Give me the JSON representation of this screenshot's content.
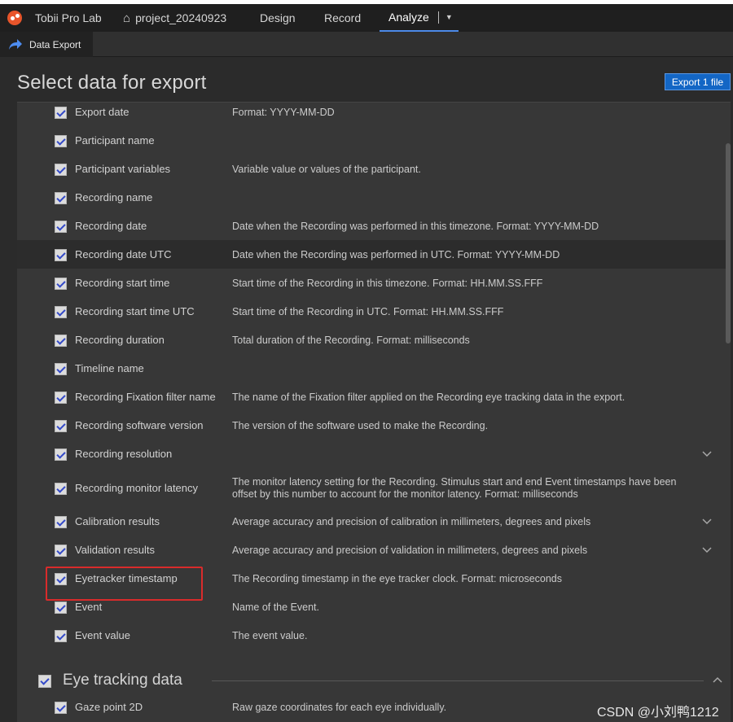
{
  "topbar": {
    "app_name": "Tobii Pro Lab",
    "project": "project_20240923",
    "tabs": [
      "Design",
      "Record",
      "Analyze"
    ],
    "active_tab": "Analyze"
  },
  "subbar": {
    "tab_label": "Data Export"
  },
  "page": {
    "title": "Select data for export",
    "export_button": "Export 1 file"
  },
  "fields": [
    {
      "name": "Export date",
      "desc": "Format: YYYY-MM-DD",
      "checked": true
    },
    {
      "name": "Participant name",
      "desc": "",
      "checked": true
    },
    {
      "name": "Participant variables",
      "desc": "Variable value or values of the participant.",
      "checked": true
    },
    {
      "name": "Recording name",
      "desc": "",
      "checked": true
    },
    {
      "name": "Recording date",
      "desc": "Date when the Recording was performed in this timezone. Format: YYYY-MM-DD",
      "checked": true
    },
    {
      "name": "Recording date UTC",
      "desc": "Date when the Recording was performed in UTC. Format: YYYY-MM-DD",
      "checked": true
    },
    {
      "name": "Recording start time",
      "desc": "Start time of the Recording in this timezone. Format: HH.MM.SS.FFF",
      "checked": true
    },
    {
      "name": "Recording start time UTC",
      "desc": "Start time of the Recording in UTC. Format: HH.MM.SS.FFF",
      "checked": true
    },
    {
      "name": "Recording duration",
      "desc": "Total duration of the Recording. Format: milliseconds",
      "checked": true
    },
    {
      "name": "Timeline name",
      "desc": "",
      "checked": true
    },
    {
      "name": "Recording Fixation filter name",
      "desc": "The name of the Fixation filter applied on the Recording eye tracking data in the export.",
      "checked": true
    },
    {
      "name": "Recording software version",
      "desc": "The version of the software used to make the Recording.",
      "checked": true
    },
    {
      "name": "Recording resolution",
      "desc": "",
      "checked": true
    },
    {
      "name": "Recording monitor latency",
      "desc": "The monitor latency setting for the Recording. Stimulus start and end Event timestamps have been offset by this number to account for the monitor latency. Format: milliseconds",
      "checked": true
    },
    {
      "name": "Calibration results",
      "desc": "Average accuracy and precision of calibration in millimeters, degrees and pixels",
      "checked": true
    },
    {
      "name": "Validation results",
      "desc": "Average accuracy and precision of validation in millimeters, degrees and pixels",
      "checked": true
    },
    {
      "name": "Eyetracker timestamp",
      "desc": "The Recording timestamp in the eye tracker clock. Format: microseconds",
      "checked": true
    },
    {
      "name": "Event",
      "desc": "Name of the Event.",
      "checked": true
    },
    {
      "name": "Event value",
      "desc": "The event value.",
      "checked": true
    }
  ],
  "section": {
    "title": "Eye tracking data",
    "fields": [
      {
        "name": "Gaze point 2D",
        "desc": "Raw gaze coordinates for each eye individually.",
        "checked": true
      }
    ]
  },
  "watermark": "CSDN @小刘鸭1212"
}
